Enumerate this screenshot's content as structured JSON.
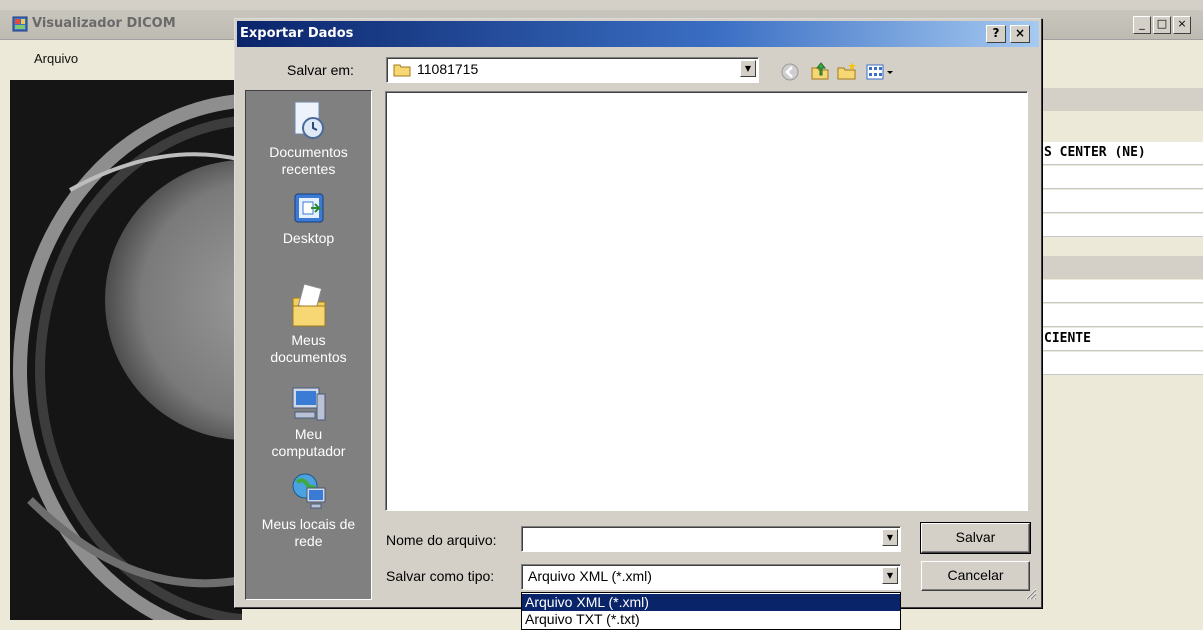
{
  "main_window": {
    "title": "Visualizador DICOM",
    "menu": [
      "Arquivo"
    ],
    "controls": [
      "_",
      "□",
      "×"
    ],
    "right_panel": {
      "row1": "S CENTER (NE)",
      "row2": "CIENTE"
    }
  },
  "dialog": {
    "title": "Exportar Dados",
    "help_button": "?",
    "close_button": "×",
    "save_in_label": "Salvar em:",
    "save_in_value": "11081715",
    "toolbar_icons": [
      "back-icon",
      "up-folder-icon",
      "new-folder-icon",
      "views-menu-icon"
    ],
    "places": [
      {
        "label": "Documentos recentes",
        "icon": "recent-documents-icon"
      },
      {
        "label": "Desktop",
        "icon": "desktop-icon"
      },
      {
        "label": "Meus documentos",
        "icon": "my-documents-icon"
      },
      {
        "label": "Meu computador",
        "icon": "my-computer-icon"
      },
      {
        "label": "Meus locais de rede",
        "icon": "network-places-icon"
      }
    ],
    "filename_label": "Nome do arquivo:",
    "filename_value": "",
    "filetype_label": "Salvar como tipo:",
    "filetype_value": "Arquivo XML (*.xml)",
    "filetype_options": [
      "Arquivo XML (*.xml)",
      "Arquivo TXT (*.txt)"
    ],
    "save_button": "Salvar",
    "cancel_button": "Cancelar"
  },
  "colors": {
    "title_active": "#0a246a",
    "selection": "#0a246a",
    "places_bar": "#808080",
    "face": "#d4d0c8"
  }
}
